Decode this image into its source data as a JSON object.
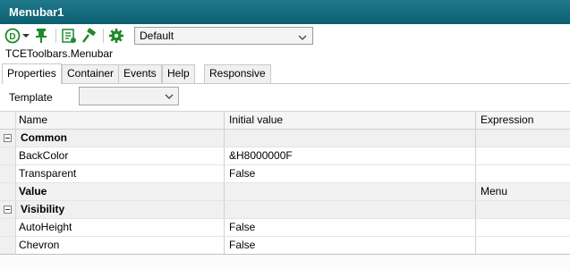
{
  "window": {
    "title": "Menubar1"
  },
  "toolbar": {
    "icons": [
      "default-dropdown-icon",
      "pin-icon",
      "properties-sheet-icon",
      "hammer-icon",
      "gear-icon"
    ],
    "combo_value": "Default"
  },
  "class_name": "TCEToolbars.Menubar",
  "tabs": [
    {
      "label": "Properties",
      "active": true
    },
    {
      "label": "Container"
    },
    {
      "label": "Events"
    },
    {
      "label": "Help"
    },
    {
      "label": "Responsive"
    }
  ],
  "template": {
    "label": "Template",
    "value": ""
  },
  "grid": {
    "columns": {
      "name": "Name",
      "initial": "Initial value",
      "expression": "Expression"
    },
    "rows": [
      {
        "type": "category",
        "name": "Common"
      },
      {
        "type": "prop",
        "name": "BackColor",
        "initial": "&H8000000F",
        "expression": ""
      },
      {
        "type": "prop",
        "name": "Transparent",
        "initial": "False",
        "expression": ""
      },
      {
        "type": "bold",
        "name": "Value",
        "initial": "",
        "expression": "Menu"
      },
      {
        "type": "category",
        "name": "Visibility"
      },
      {
        "type": "prop",
        "name": "AutoHeight",
        "initial": "False",
        "expression": ""
      },
      {
        "type": "prop",
        "name": "Chevron",
        "initial": "False",
        "expression": ""
      }
    ]
  },
  "colors": {
    "titlebar": "#137082",
    "icon_green": "#1e8a2a"
  }
}
